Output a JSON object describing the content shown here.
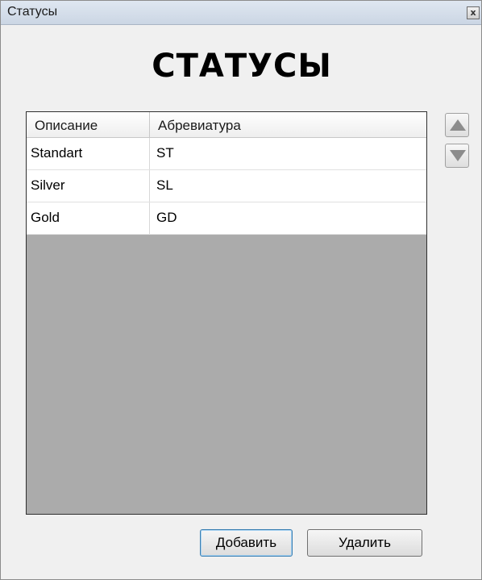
{
  "window": {
    "title": "Статусы",
    "close_glyph": "x"
  },
  "heading": "СТАТУСЫ",
  "table": {
    "columns": [
      "Описание",
      "Абревиатура"
    ],
    "rows": [
      {
        "description": "Standart",
        "abbreviation": "ST"
      },
      {
        "description": "Silver",
        "abbreviation": "SL"
      },
      {
        "description": "Gold",
        "abbreviation": "GD"
      }
    ]
  },
  "side_buttons": {
    "up_icon": "triangle-up-icon",
    "down_icon": "triangle-down-icon"
  },
  "buttons": {
    "add_label": "Добавить",
    "delete_label": "Удалить"
  },
  "colors": {
    "empty_grid": "#ababab",
    "primary_button_border": "#3c7fb1"
  }
}
